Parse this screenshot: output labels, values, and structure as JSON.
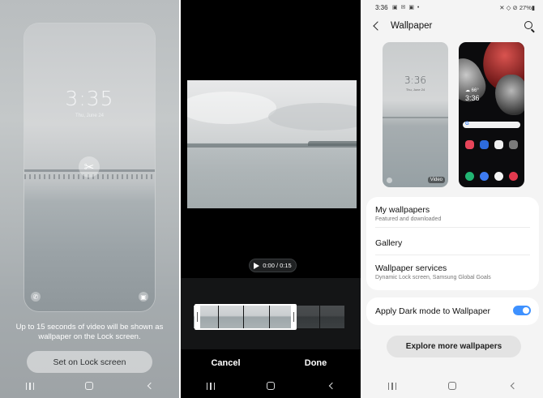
{
  "panel_lock_preview": {
    "clock": "3:35",
    "date": "Thu, June 24",
    "caption": "Up to 15 seconds of video will be shown as wallpaper on the Lock screen.",
    "set_button": "Set on Lock screen",
    "icons": [
      "scissors-icon",
      "phone-icon",
      "camera-icon"
    ]
  },
  "panel_trim": {
    "time_display": "0:00 / 0:15",
    "cancel": "Cancel",
    "done": "Done"
  },
  "panel_wallpaper": {
    "status": {
      "time": "3:36",
      "notif_icons": "▣ ✉ ▣ •",
      "right": "✕ ◇ ⊘ 27%▮"
    },
    "title": "Wallpaper",
    "lock_thumb_clock": "3:36",
    "lock_thumb_date": "Thu, June 24",
    "video_badge": "Video",
    "home_thumb_clock": "3:36",
    "home_thumb_weather": "☁ 66°",
    "items": [
      {
        "title": "My wallpapers",
        "subtitle": "Featured and downloaded"
      },
      {
        "title": "Gallery",
        "subtitle": ""
      },
      {
        "title": "Wallpaper services",
        "subtitle": "Dynamic Lock screen, Samsung Global Goals"
      }
    ],
    "dark_mode_label": "Apply Dark mode to Wallpaper",
    "dark_mode_on": true,
    "explore_button": "Explore more wallpapers",
    "accent_color": "#3e91ff"
  }
}
